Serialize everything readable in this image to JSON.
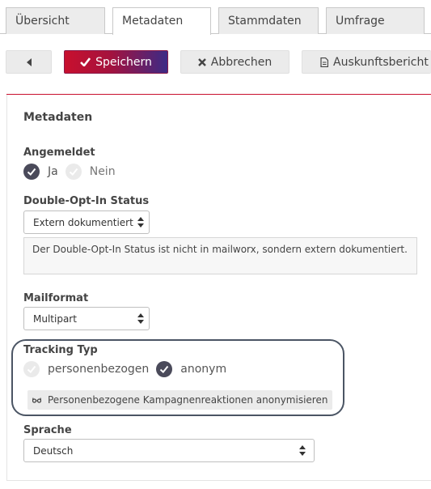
{
  "tabs": [
    {
      "label": "Übersicht"
    },
    {
      "label": "Metadaten"
    },
    {
      "label": "Stammdaten"
    },
    {
      "label": "Umfrage"
    }
  ],
  "toolbar": {
    "save_label": "Speichern",
    "cancel_label": "Abbrechen",
    "report_label": "Auskunftsbericht",
    "primary_color": "#c8102e"
  },
  "section": {
    "title": "Metadaten"
  },
  "angemeldet": {
    "label": "Angemeldet",
    "options": [
      {
        "label": "Ja",
        "checked": true
      },
      {
        "label": "Nein",
        "checked": false
      }
    ]
  },
  "double_opt_in": {
    "label": "Double-Opt-In Status",
    "value": "Extern dokumentiert",
    "info": "Der Double-Opt-In Status ist nicht in mailworx, sondern extern dokumentiert."
  },
  "mailformat": {
    "label": "Mailformat",
    "value": "Multipart"
  },
  "tracking": {
    "label": "Tracking Typ",
    "options": [
      {
        "label": "personenbezogen",
        "checked": false
      },
      {
        "label": "anonym",
        "checked": true
      }
    ],
    "anonymize_label": "Personenbezogene Kampagnenreaktionen anonymisieren"
  },
  "sprache": {
    "label": "Sprache",
    "value": "Deutsch"
  }
}
